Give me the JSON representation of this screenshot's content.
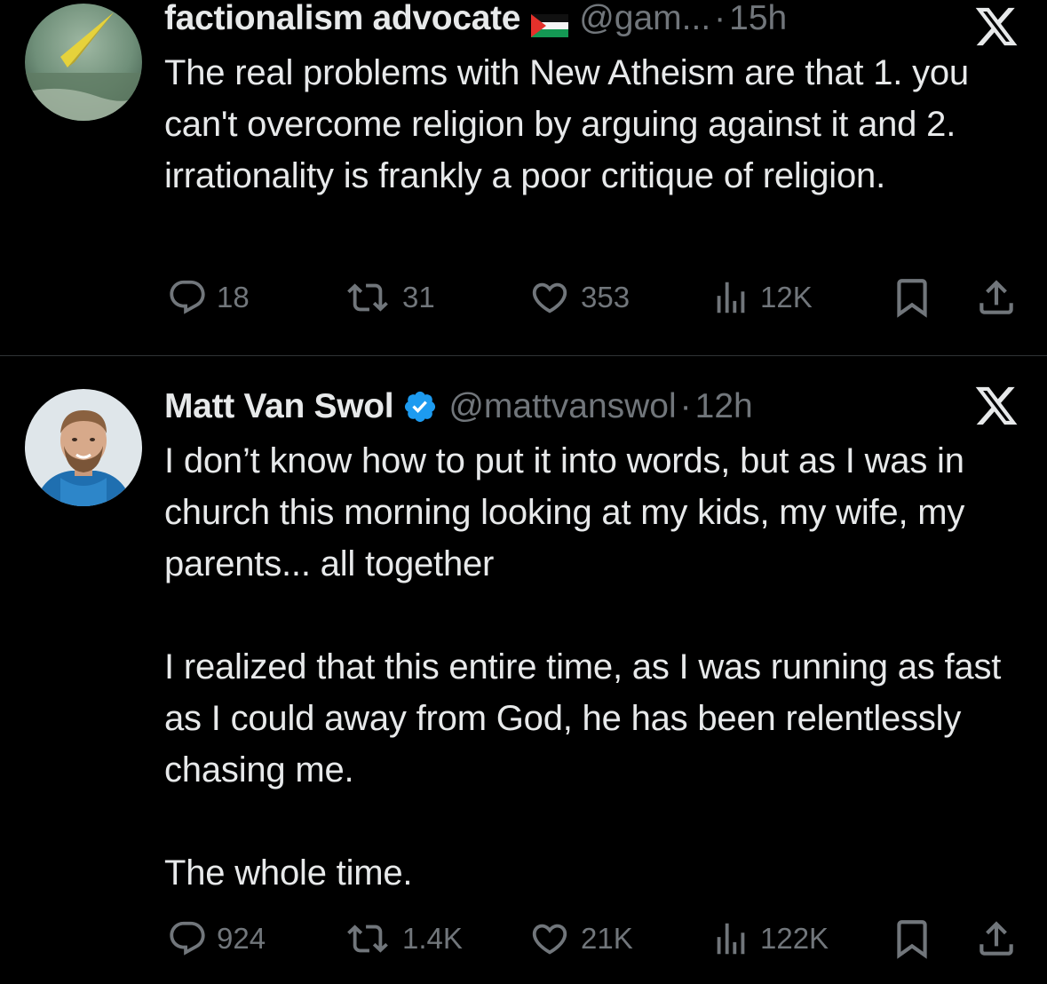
{
  "tweets": [
    {
      "author_name": "factionalism advocate",
      "flag_icon": "palestine-flag-icon",
      "handle": "@gam...",
      "dot": "·",
      "time": "15h",
      "platform_icon": "x-logo-icon",
      "text": [
        "The real problems with New Atheism are that 1. you can't overcome religion by arguing against it and 2. irrationality is frankly a poor critique of religion."
      ],
      "stats": {
        "replies": "18",
        "reposts": "31",
        "likes": "353",
        "views": "12K"
      }
    },
    {
      "author_name": "Matt Van Swol",
      "verified": true,
      "handle": "@mattvanswol",
      "dot": "·",
      "time": "12h",
      "platform_icon": "x-logo-icon",
      "text": [
        "I don’t know how to put it into words, but as I was in church this morning looking at my kids, my wife, my parents... all together",
        "I realized that this entire time, as I was running as fast as I could away from God, he has been relentlessly chasing me.",
        "The whole time."
      ],
      "stats": {
        "replies": "924",
        "reposts": "1.4K",
        "likes": "21K",
        "views": "122K"
      }
    }
  ],
  "colors": {
    "background": "#000000",
    "text": "#e7e9ea",
    "muted": "#71767b",
    "verified": "#1d9bf0",
    "divider": "#2f3336"
  }
}
